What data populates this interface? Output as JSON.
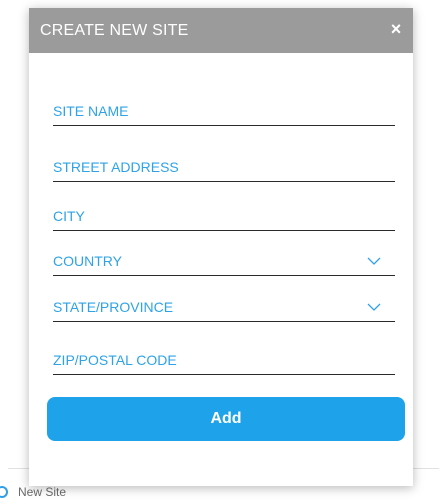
{
  "modal": {
    "title": "CREATE NEW SITE",
    "close_icon": "×",
    "fields": [
      {
        "label": "SITE NAME",
        "icon": ""
      },
      {
        "label": "STREET ADDRESS",
        "icon": ""
      },
      {
        "label": "CITY",
        "icon": ""
      },
      {
        "label": "COUNTRY",
        "icon": "chevron-down-icon"
      },
      {
        "label": "STATE/PROVINCE",
        "icon": "chevron-down-icon"
      },
      {
        "label": "ZIP/POSTAL CODE",
        "icon": ""
      }
    ],
    "add_label": "Add"
  },
  "background": {
    "item_label": "New Site"
  },
  "colors": {
    "header": "#9b9b9b",
    "accent": "#2ea3e6",
    "button": "#1ea3ea"
  }
}
